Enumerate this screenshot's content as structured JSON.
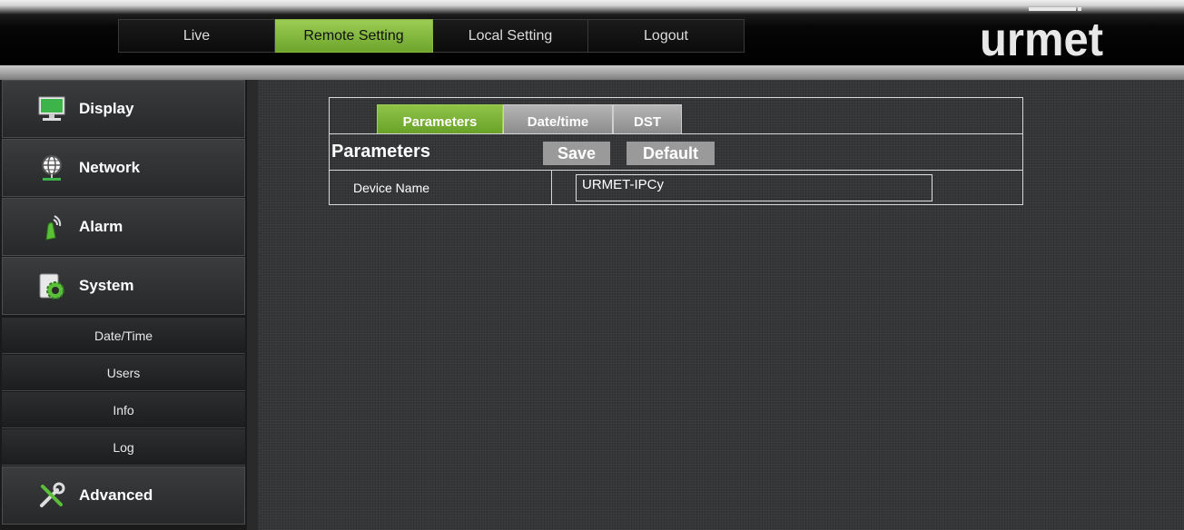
{
  "nav": {
    "tabs": [
      {
        "label": "Live",
        "active": false
      },
      {
        "label": "Remote Setting",
        "active": true
      },
      {
        "label": "Local Setting",
        "active": false
      },
      {
        "label": "Logout",
        "active": false
      }
    ]
  },
  "brand": {
    "logo_text": "urmet"
  },
  "sidebar": {
    "items": [
      {
        "label": "Display",
        "icon": "monitor-icon"
      },
      {
        "label": "Network",
        "icon": "globe-network-icon"
      },
      {
        "label": "Alarm",
        "icon": "alarm-siren-icon"
      },
      {
        "label": "System",
        "icon": "system-gear-icon"
      }
    ],
    "system_subitems": [
      "Date/Time",
      "Users",
      "Info",
      "Log"
    ],
    "advanced": {
      "label": "Advanced",
      "icon": "tools-icon"
    }
  },
  "panel": {
    "tabs": [
      {
        "label": "Parameters",
        "active": true
      },
      {
        "label": "Date/time",
        "active": false
      },
      {
        "label": "DST",
        "active": false
      }
    ],
    "title": "Parameters",
    "save_label": "Save",
    "default_label": "Default",
    "device_name_label": "Device Name",
    "device_name_value": "URMET-IPCy"
  },
  "colors": {
    "accent_green": "#7ab536",
    "tab_grey": "#9a9a9a",
    "content_bg": "#343638"
  }
}
